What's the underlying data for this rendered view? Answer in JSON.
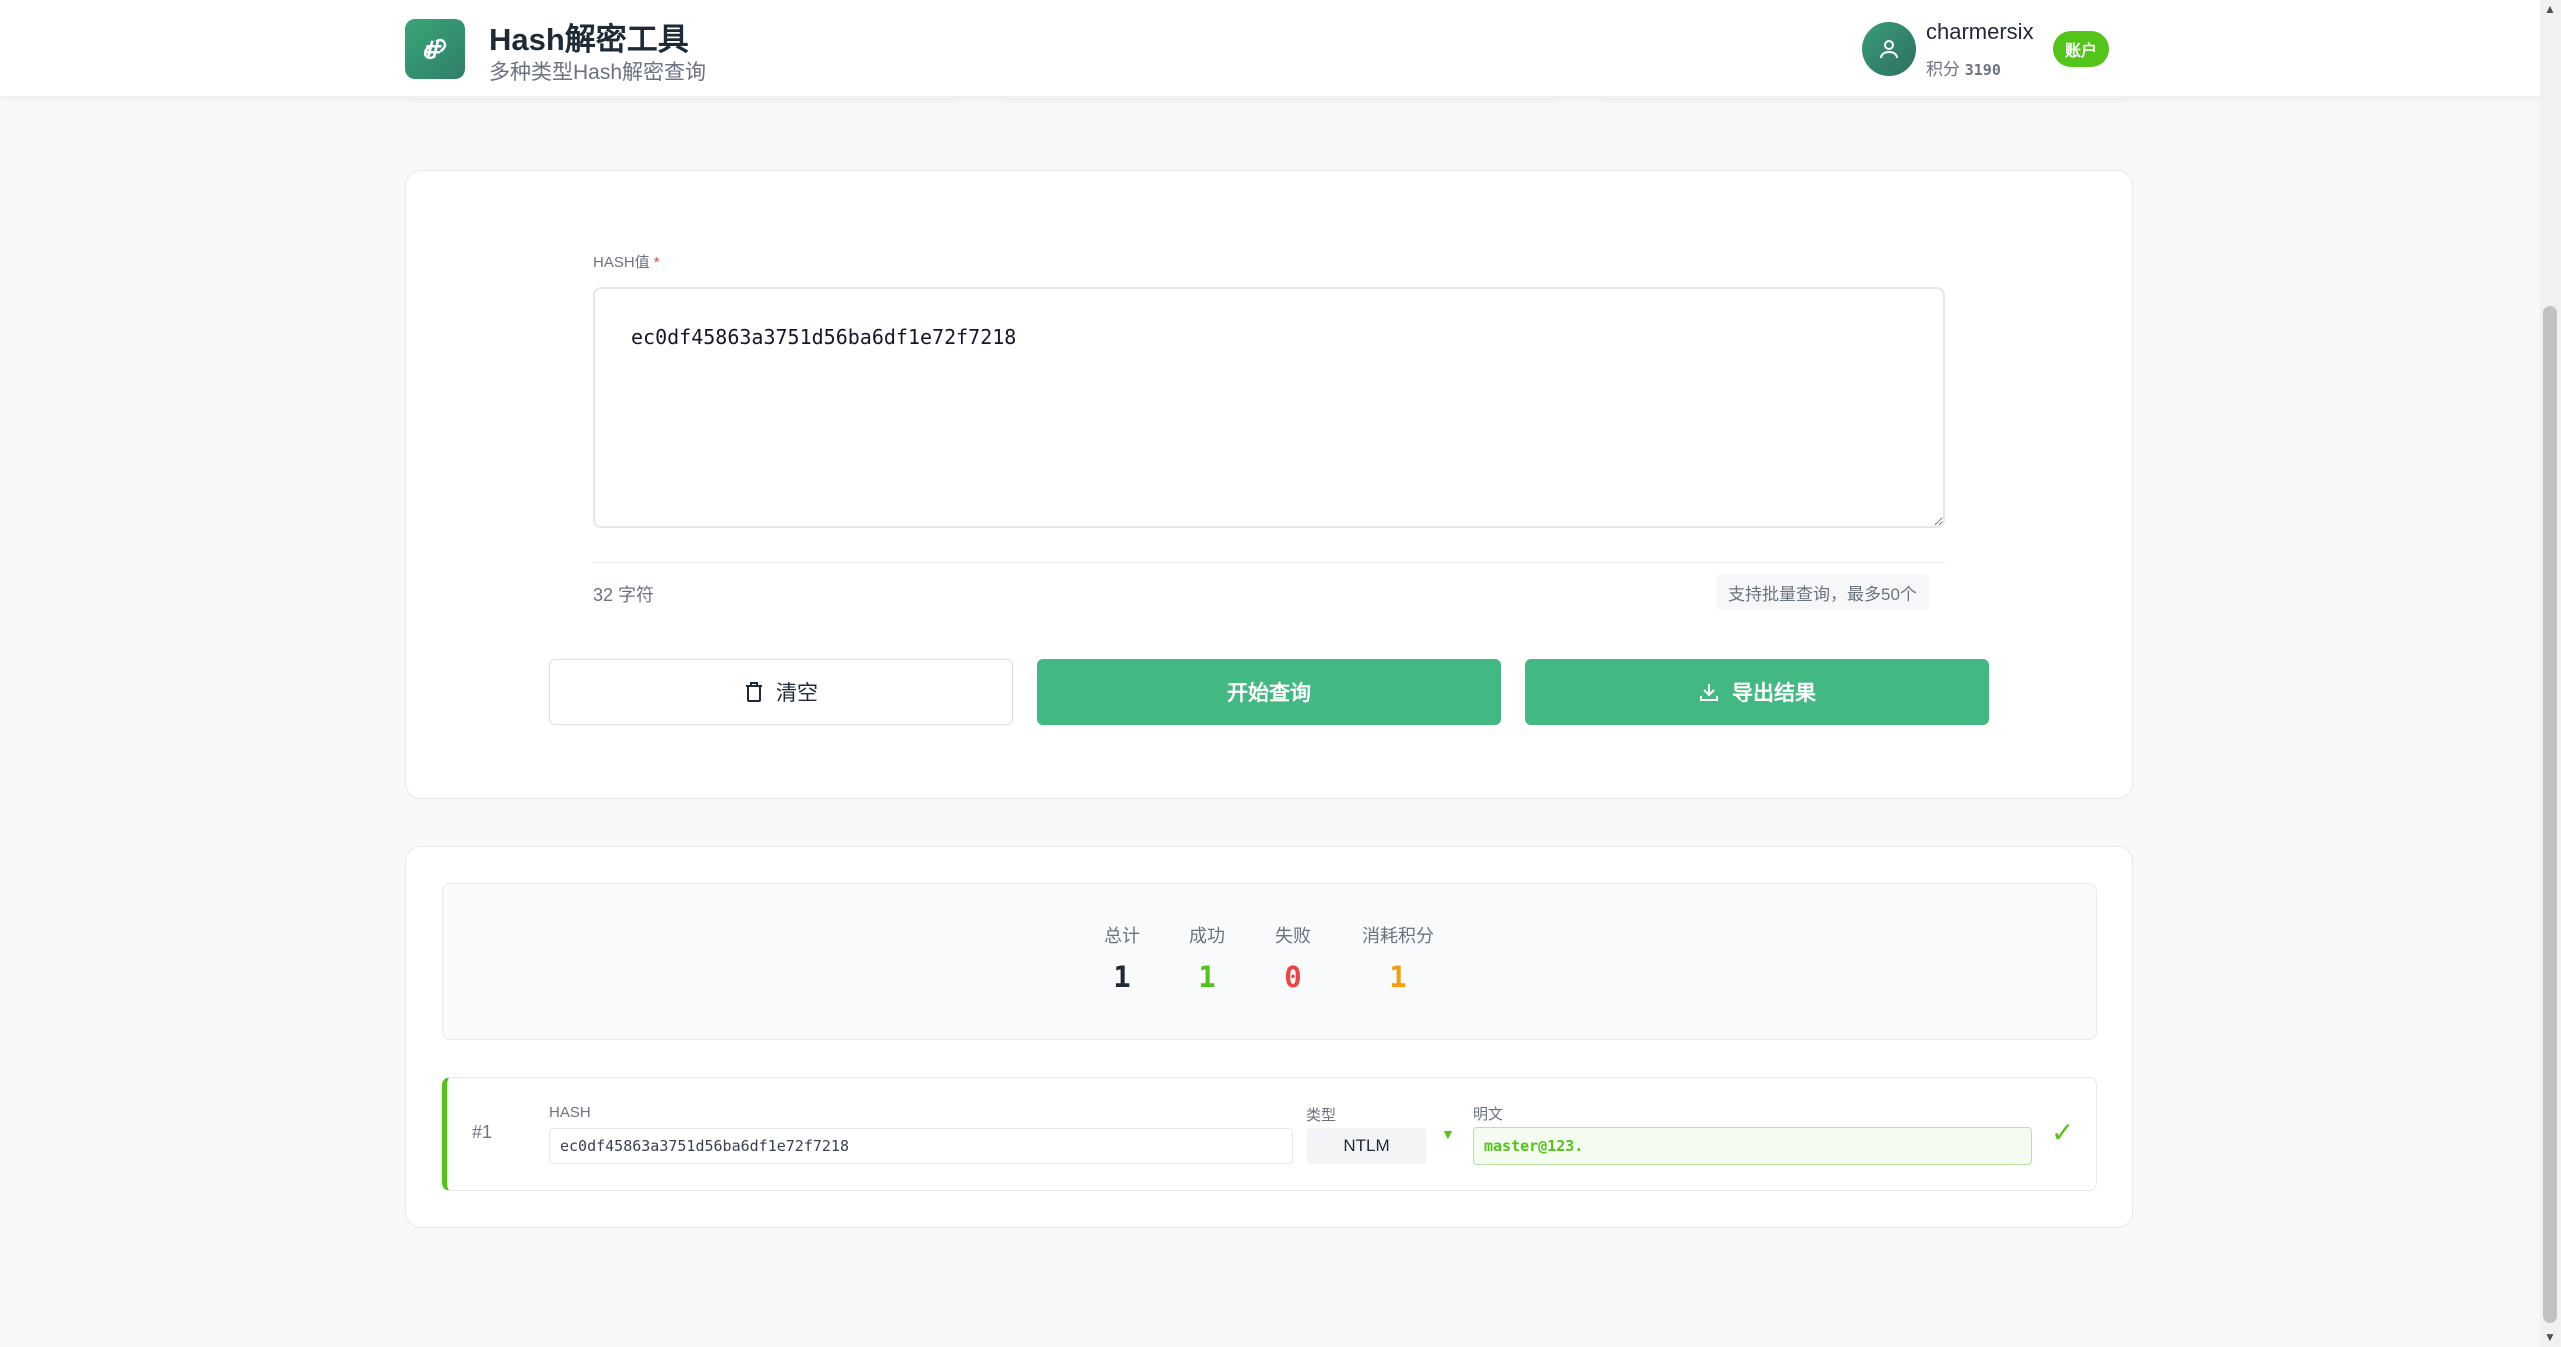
{
  "header": {
    "title": "Hash解密工具",
    "subtitle": "多种类型Hash解密查询",
    "user": {
      "name": "charmersix",
      "points_label": "积分",
      "points_value": "3190",
      "account_badge": "账户"
    }
  },
  "form": {
    "label": "HASH值",
    "required_mark": "*",
    "hash_value": "ec0df45863a3751d56ba6df1e72f7218",
    "char_count": "32 字符",
    "batch_tip": "支持批量查询，最多50个",
    "buttons": {
      "clear": "清空",
      "query": "开始查询",
      "export": "导出结果"
    }
  },
  "stats": {
    "total_label": "总计",
    "total_value": "1",
    "success_label": "成功",
    "success_value": "1",
    "fail_label": "失败",
    "fail_value": "0",
    "cost_label": "消耗积分",
    "cost_value": "1"
  },
  "results": [
    {
      "index": "#1",
      "hash_label": "HASH",
      "hash": "ec0df45863a3751d56ba6df1e72f7218",
      "type_label": "类型",
      "type": "NTLM",
      "plain_label": "明文",
      "plain": "master@123."
    }
  ],
  "colors": {
    "primary": "#42b883",
    "success": "#52c41a",
    "fail": "#ef4444",
    "cost": "#f59e0b"
  }
}
